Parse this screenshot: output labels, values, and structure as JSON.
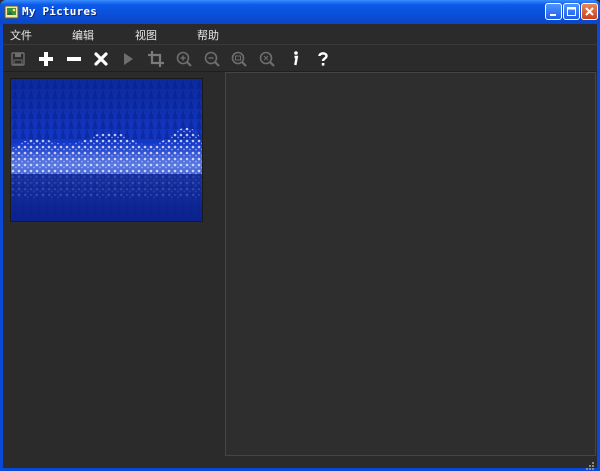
{
  "window": {
    "title": "My Pictures"
  },
  "titlebar": {
    "icon": "picture-folder-icon",
    "buttons": [
      {
        "name": "minimize-button",
        "icon": "minimize-icon"
      },
      {
        "name": "maximize-button",
        "icon": "maximize-icon"
      },
      {
        "name": "close-button",
        "icon": "close-icon"
      }
    ]
  },
  "menu": {
    "items": [
      "文件",
      "编辑",
      "视图",
      "帮助"
    ]
  },
  "toolbar": {
    "buttons": [
      {
        "name": "save",
        "icon": "save-icon",
        "enabled": false
      },
      {
        "name": "add",
        "icon": "plus-icon",
        "enabled": true
      },
      {
        "name": "remove",
        "icon": "minus-icon",
        "enabled": true
      },
      {
        "name": "delete",
        "icon": "x-icon",
        "enabled": true
      },
      {
        "name": "slideshow",
        "icon": "play-icon",
        "enabled": false
      },
      {
        "name": "crop",
        "icon": "crop-icon",
        "enabled": false
      },
      {
        "name": "zoom-in",
        "icon": "zoom-in-icon",
        "enabled": false
      },
      {
        "name": "zoom-out",
        "icon": "zoom-out-icon",
        "enabled": false
      },
      {
        "name": "zoom-fit",
        "icon": "zoom-fit-icon",
        "enabled": false
      },
      {
        "name": "zoom-actual",
        "icon": "zoom-actual-icon",
        "enabled": false
      },
      {
        "name": "info",
        "icon": "info-icon",
        "enabled": true
      },
      {
        "name": "help",
        "icon": "help-icon",
        "enabled": true
      }
    ]
  },
  "thumbnails": [
    {
      "subject": "snowy blue forest"
    }
  ],
  "colors": {
    "titlebar": "#0c5ae9",
    "background": "#2b2b2b",
    "text": "#e6e6e6",
    "icon_enabled": "#ffffff",
    "icon_disabled": "#6e6e6e"
  }
}
